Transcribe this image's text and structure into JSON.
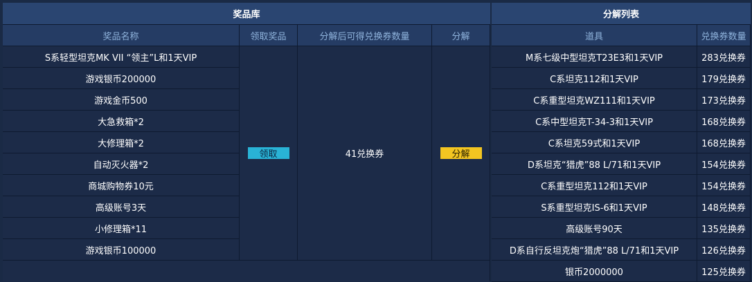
{
  "prize_pool": {
    "title": "奖品库",
    "headers": {
      "name": "奖品名称",
      "claim": "领取奖品",
      "vouchers_after": "分解后可得兑换券数量",
      "decompose": "分解"
    },
    "items": [
      "S系轻型坦克MK VII “领主”L和1天VIP",
      "游戏银币200000",
      "游戏金币500",
      "大急救箱*2",
      "大修理箱*2",
      "自动灭火器*2",
      "商城购物券10元",
      "高级账号3天",
      "小修理箱*11",
      "游戏银币100000"
    ],
    "claim_button": "领取",
    "vouchers_value": "41兑换券",
    "decompose_button": "分解"
  },
  "decompose_list": {
    "title": "分解列表",
    "headers": {
      "item": "道具",
      "vouchers": "兑换券数量"
    },
    "rows": [
      {
        "item": "M系七级中型坦克T23E3和1天VIP",
        "vouchers": "283兑换券"
      },
      {
        "item": "C系坦克112和1天VIP",
        "vouchers": "179兑换券"
      },
      {
        "item": "C系重型坦克WZ111和1天VIP",
        "vouchers": "173兑换券"
      },
      {
        "item": "C系中型坦克T-34-3和1天VIP",
        "vouchers": "168兑换券"
      },
      {
        "item": "C系坦克59式和1天VIP",
        "vouchers": "168兑换券"
      },
      {
        "item": "D系坦克“猎虎”88 L/71和1天VIP",
        "vouchers": "154兑换券"
      },
      {
        "item": "C系重型坦克112和1天VIP",
        "vouchers": "154兑换券"
      },
      {
        "item": "S系重型坦克IS-6和1天VIP",
        "vouchers": "148兑换券"
      },
      {
        "item": "高级账号90天",
        "vouchers": "135兑换券"
      },
      {
        "item": "D系自行反坦克炮“猎虎”88 L/71和1天VIP",
        "vouchers": "126兑换券"
      },
      {
        "item": "银币2000000",
        "vouchers": "125兑换券"
      }
    ]
  },
  "colors": {
    "claim_button": "#29b3d6",
    "decompose_button": "#f3c521",
    "header_text": "#8fb3dc",
    "title_bar": "#2a4571"
  }
}
